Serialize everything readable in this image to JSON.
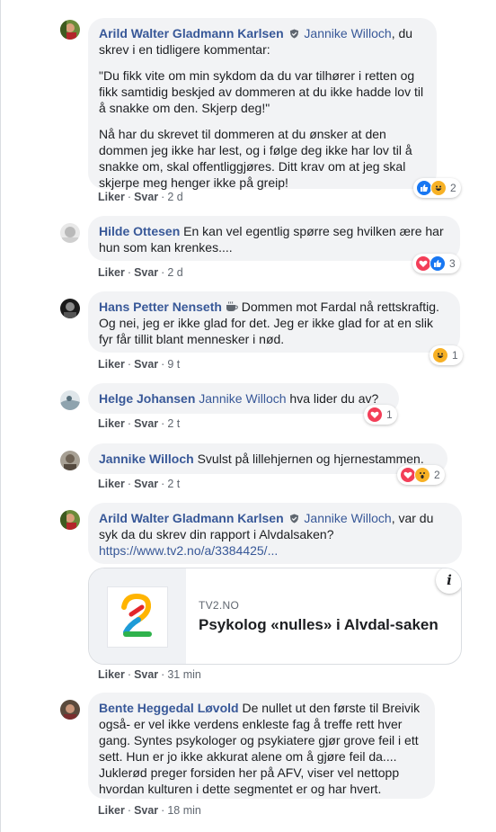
{
  "comments": [
    {
      "author": "Arild Walter Gladmann Karlsen",
      "mention": "Jannike Willoch",
      "text_after_mention": ", du skrev i en tidligere kommentar:",
      "paragraph2": "\"Du fikk vite om min sykdom da du var tilhører i retten og fikk samtidig beskjed av dommeren at du ikke hadde lov til å snakke om den. Skjerp deg!\"",
      "paragraph3": "Nå har du skrevet til dommeren at du ønsker at den dommen jeg ikke har lest, og i følge deg ikke har lov til å snakke om, skal offentliggjøres. Ditt krav om at jeg skal skjerpe meg henger ikke på greip!",
      "like": "Liker",
      "reply": "Svar",
      "time": "2 d",
      "reaction_count": "2"
    },
    {
      "author": "Hilde Ottesen",
      "text": "En kan vel egentlig spørre seg hvilken ære har hun som kan krenkes....",
      "like": "Liker",
      "reply": "Svar",
      "time": "2 d",
      "reaction_count": "3"
    },
    {
      "author": "Hans Petter Nenseth",
      "text": "Dommen mot Fardal nå rettskraftig. Og nei, jeg er ikke glad for det. Jeg er ikke glad for at en slik fyr får tillit blant mennesker i nød.",
      "like": "Liker",
      "reply": "Svar",
      "time": "9 t",
      "reaction_count": "1"
    },
    {
      "author": "Helge Johansen",
      "mention": "Jannike Willoch",
      "text": "hva lider du av?",
      "like": "Liker",
      "reply": "Svar",
      "time": "2 t",
      "reaction_count": "1"
    },
    {
      "author": "Jannike Willoch",
      "text": "Svulst på lillehjernen og hjernestammen.",
      "like": "Liker",
      "reply": "Svar",
      "time": "2 t",
      "reaction_count": "2"
    },
    {
      "author": "Arild Walter Gladmann Karlsen",
      "mention": "Jannike Willoch",
      "text": ", var du syk da du skrev din rapport i Alvdalsaken?",
      "link": "https://www.tv2.no/a/3384425/...",
      "card_domain": "TV2.NO",
      "card_title": "Psykolog «nulles» i Alvdal-saken",
      "info_icon": "i",
      "like": "Liker",
      "reply": "Svar",
      "time": "31 min"
    },
    {
      "author": "Bente Heggedal Løvold",
      "text": "De nullet ut den første til Breivik også- er vel ikke verdens enkleste fag å treffe rett hver gang. Syntes psykologer og psykiatere gjør grove feil i ett sett. Hun er jo ikke akkurat alene om å gjøre feil da.... Juklerød preger forsiden her på AFV, viser vel nettopp hvordan kulturen i dette segmentet er og har hvert.",
      "like": "Liker",
      "reply": "Svar",
      "time": "18 min"
    }
  ],
  "colors": {
    "link": "#385898",
    "bubble": "#f2f3f5",
    "like": "#1877f2",
    "love": "#f33e58",
    "haha": "#f7b125"
  }
}
